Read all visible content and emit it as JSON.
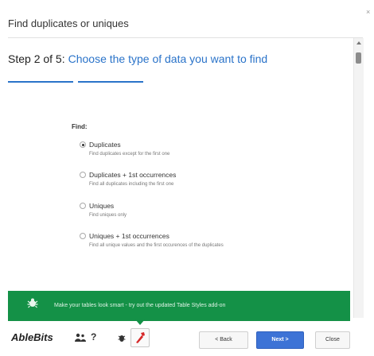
{
  "dialog": {
    "title": "Find duplicates or uniques",
    "close_glyph": "×"
  },
  "step": {
    "number": "Step 2 of 5:",
    "description": "Choose the type of data you want to find"
  },
  "find": {
    "label": "Find:",
    "options": [
      {
        "label": "Duplicates",
        "description": "Find duplicates except for the first one",
        "selected": true
      },
      {
        "label": "Duplicates + 1st occurrences",
        "description": "Find all duplicates including the first one",
        "selected": false
      },
      {
        "label": "Uniques",
        "description": "Find uniques only",
        "selected": false
      },
      {
        "label": "Uniques + 1st occurrences",
        "description": "Find all unique values and the first occurences of the duplicates",
        "selected": false
      }
    ]
  },
  "banner": {
    "text": "Make your tables look smart - try out the updated Table Styles add-on",
    "color": "#149147"
  },
  "footer": {
    "brand": "AbleBits",
    "help_glyph": "?",
    "back_label": "< Back",
    "next_label": "Next >",
    "close_label": "Close"
  },
  "colors": {
    "accent": "#2a73c9",
    "primary_button": "#3d73d6"
  }
}
